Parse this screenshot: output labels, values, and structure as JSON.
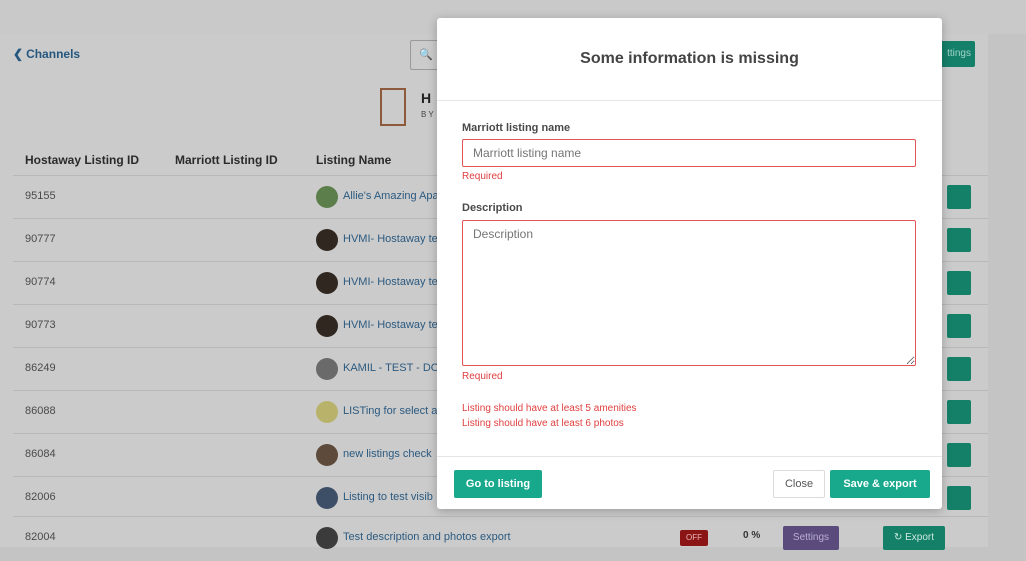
{
  "header": {
    "back_label": "Channels",
    "settings_label": "ttings"
  },
  "logo": {
    "letter": "H",
    "sub": "BY"
  },
  "table": {
    "columns": [
      "Hostaway Listing ID",
      "Marriott Listing ID",
      "Listing Name"
    ],
    "rows": [
      {
        "id": "95155",
        "name": "Allie's Amazing Apa"
      },
      {
        "id": "90777",
        "name": "HVMI- Hostaway te"
      },
      {
        "id": "90774",
        "name": "HVMI- Hostaway te"
      },
      {
        "id": "90773",
        "name": "HVMI- Hostaway te"
      },
      {
        "id": "86249",
        "name": "KAMIL - TEST - DOI"
      },
      {
        "id": "86088",
        "name": "LISTing for select a"
      },
      {
        "id": "86084",
        "name": "new listings check"
      },
      {
        "id": "82006",
        "name": "Listing to test visib"
      },
      {
        "id": "82004",
        "name": "Test description and photos export",
        "status": "OFF",
        "percent": "0 %",
        "settings": "Settings",
        "export": "Export"
      }
    ]
  },
  "modal": {
    "title": "Some information is missing",
    "name_label": "Marriott listing name",
    "name_placeholder": "Marriott listing name",
    "name_error": "Required",
    "desc_label": "Description",
    "desc_placeholder": "Description",
    "desc_error": "Required",
    "warning_1": "Listing should have at least 5 amenities",
    "warning_2": "Listing should have at least 6 photos",
    "go_label": "Go to listing",
    "close_label": "Close",
    "save_label": "Save & export"
  },
  "colors": {
    "primary": "#18a98d",
    "error": "#e03e3e",
    "link": "#2b5a80"
  }
}
